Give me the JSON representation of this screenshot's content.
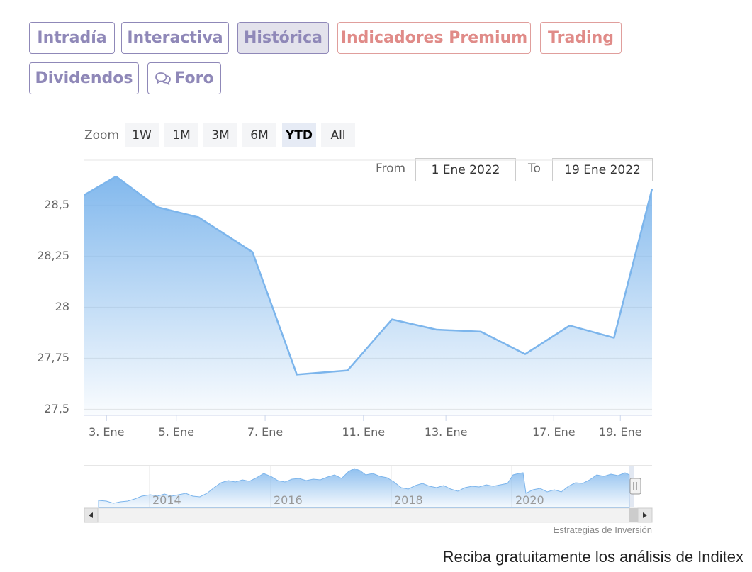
{
  "tabs": [
    {
      "label": "Intradía",
      "kind": "normal"
    },
    {
      "label": "Interactiva",
      "kind": "normal"
    },
    {
      "label": "Histórica",
      "kind": "active"
    },
    {
      "label": "Indicadores Premium",
      "kind": "premium"
    },
    {
      "label": "Trading",
      "kind": "premium"
    },
    {
      "label": "Dividendos",
      "kind": "normal"
    },
    {
      "label": "Foro",
      "kind": "normal",
      "icon": "chat-bubbles-icon"
    }
  ],
  "range_selector": {
    "zoom_label": "Zoom",
    "buttons": [
      "1W",
      "1M",
      "3M",
      "6M",
      "YTD",
      "All"
    ],
    "selected": "YTD",
    "from_label": "From",
    "from_value": "1 Ene 2022",
    "to_label": "To",
    "to_value": "19 Ene 2022"
  },
  "navigator": {
    "tick_labels": [
      "2014",
      "2016",
      "2018",
      "2020"
    ]
  },
  "credits": "Estrategias de Inversión",
  "cta_text": "Reciba gratuitamente los análisis de Inditex",
  "colors": {
    "tab_normal": "#8f88b8",
    "tab_premium": "#e08b88",
    "series_line": "#7cb5ec",
    "gridline": "#e6e6e6"
  },
  "chart_data": {
    "type": "area",
    "title": "",
    "xlabel": "",
    "ylabel": "",
    "x_tick_labels": [
      "3. Ene",
      "5. Ene",
      "7. Ene",
      "11. Ene",
      "13. Ene",
      "17. Ene",
      "19. Ene"
    ],
    "x_tick_positions": [
      2.6,
      4.8,
      7.6,
      10.7,
      13.3,
      16.7,
      18.8
    ],
    "y_tick_labels": [
      "28,5",
      "28,25",
      "28",
      "27,75",
      "27,5"
    ],
    "ylim": [
      27.47,
      28.72
    ],
    "xlim": [
      1.9,
      19.8
    ],
    "grid": true,
    "legend": "none",
    "series": [
      {
        "x": [
          1.9,
          2.9,
          4.2,
          5.5,
          7.2,
          8.6,
          10.2,
          11.6,
          13.0,
          14.4,
          15.8,
          17.2,
          18.6,
          19.8
        ],
        "values": [
          28.55,
          28.64,
          28.49,
          28.44,
          28.27,
          27.67,
          27.69,
          27.94,
          27.89,
          27.88,
          27.77,
          27.91,
          27.85,
          28.58
        ]
      }
    ]
  }
}
